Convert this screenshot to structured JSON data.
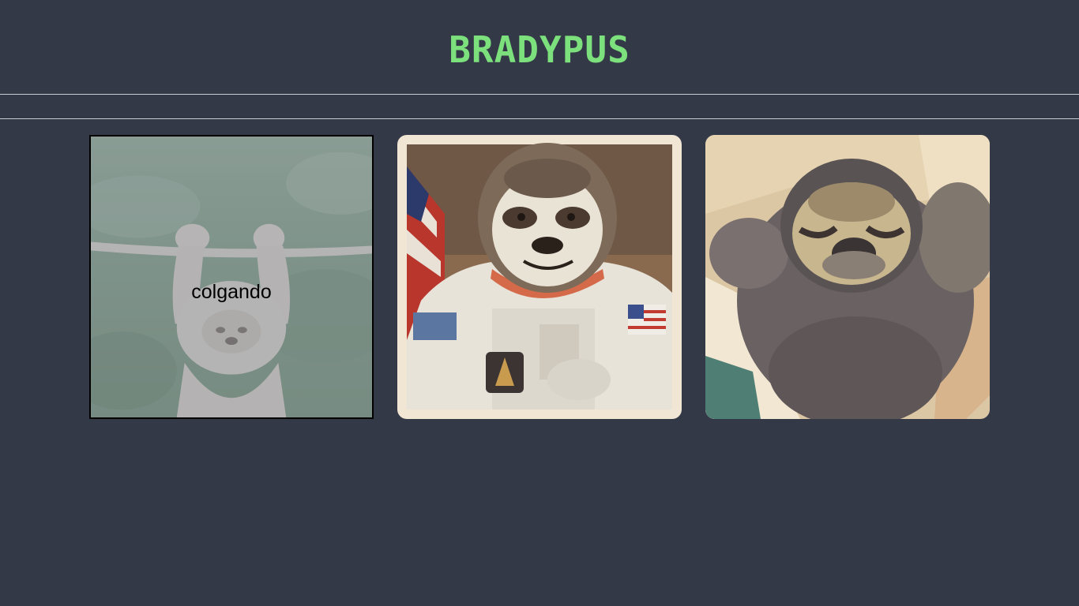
{
  "header": {
    "title": "BRADYPUS"
  },
  "gallery": {
    "cards": [
      {
        "caption": "colgando"
      }
    ]
  },
  "colors": {
    "background": "#343948",
    "title": "#7ce07c",
    "divider": "#c9ccd4"
  }
}
